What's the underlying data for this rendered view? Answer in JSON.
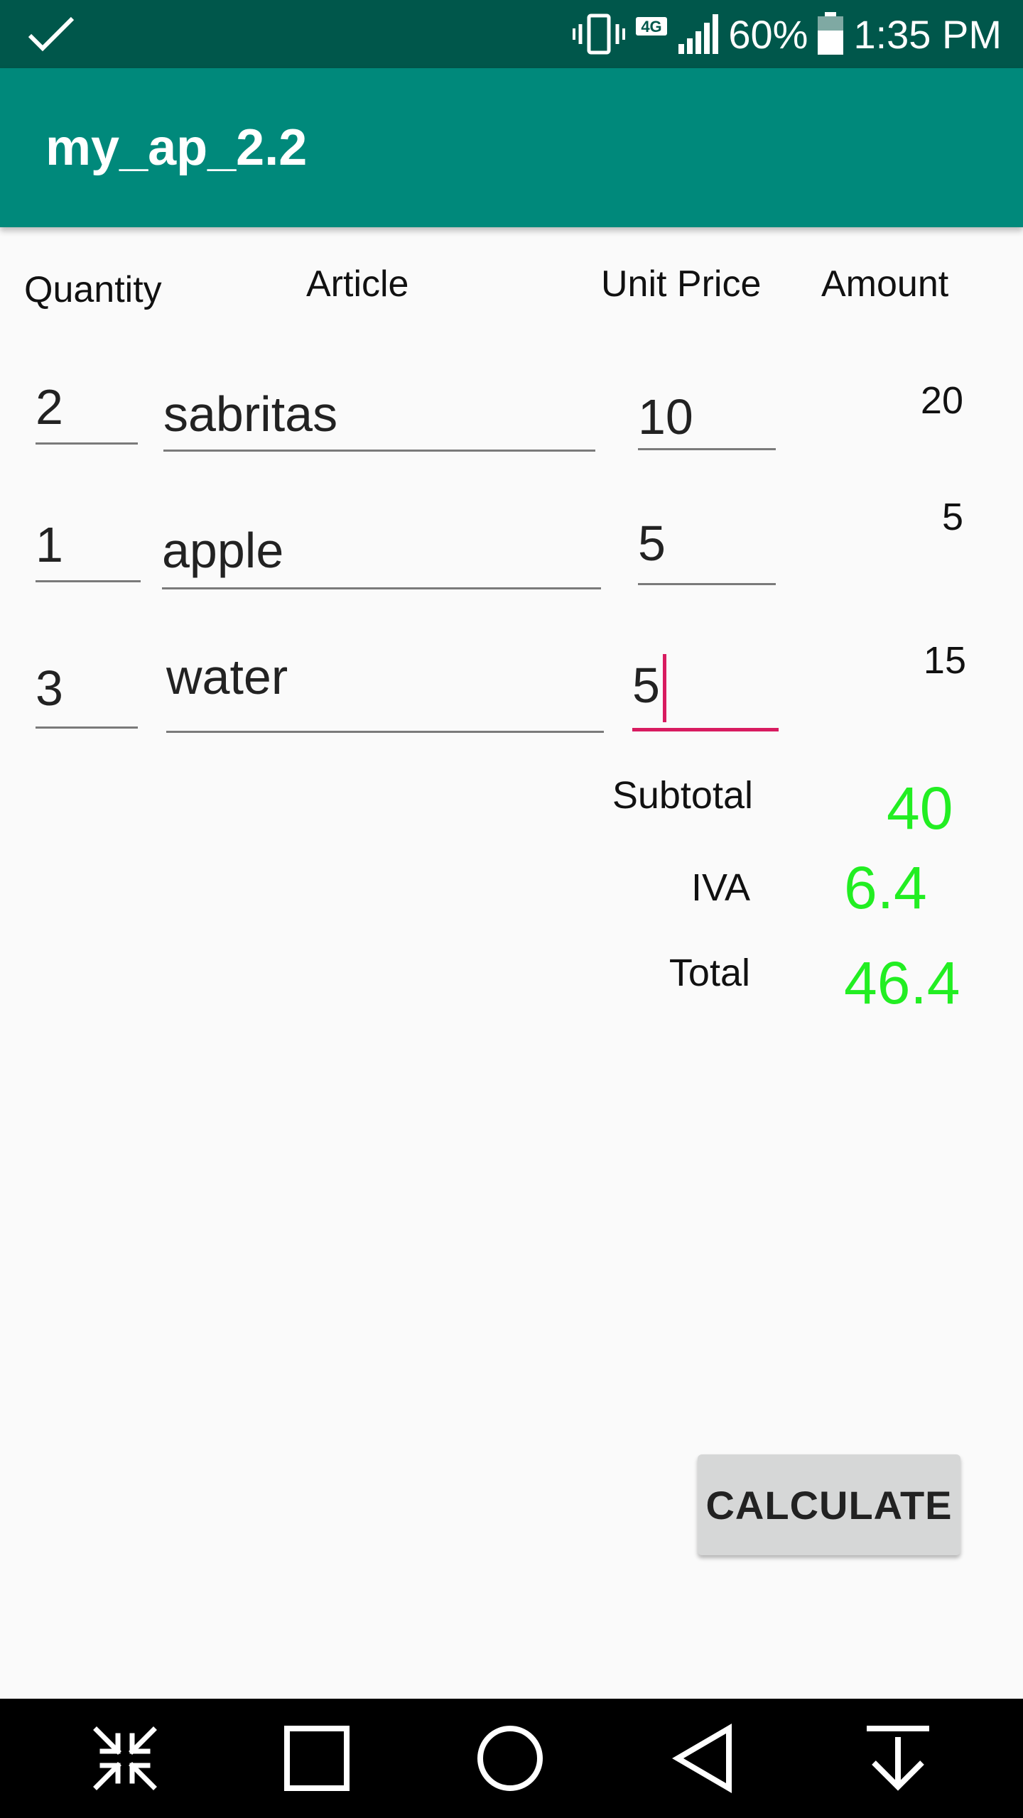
{
  "status_bar": {
    "network": "4G",
    "battery": "60%",
    "time": "1:35 PM"
  },
  "app_bar": {
    "title": "my_ap_2.2"
  },
  "headers": {
    "quantity": "Quantity",
    "article": "Article",
    "unit_price": "Unit Price",
    "amount": "Amount"
  },
  "rows": [
    {
      "quantity": "2",
      "article": "sabritas",
      "unit_price": "10",
      "amount": "20"
    },
    {
      "quantity": "1",
      "article": "apple",
      "unit_price": "5",
      "amount": "5"
    },
    {
      "quantity": "3",
      "article": "water",
      "unit_price": "5",
      "amount": "15"
    }
  ],
  "summary": {
    "subtotal_label": "Subtotal",
    "subtotal": "40",
    "iva_label": "IVA",
    "iva": "6.4",
    "total_label": "Total",
    "total": "46.4"
  },
  "calculate_label": "CALCULATE",
  "colors": {
    "status_bar": "#00574b",
    "app_bar": "#00897b",
    "accent": "#d81b60",
    "result_green": "#22ee22"
  }
}
